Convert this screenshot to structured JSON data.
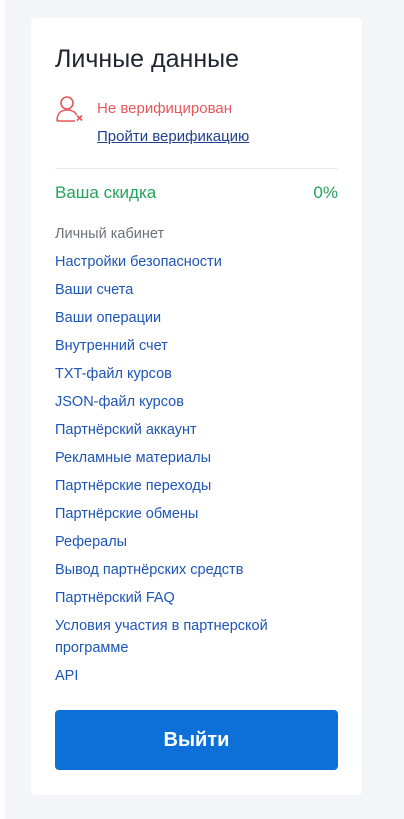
{
  "profile": {
    "title": "Личные данные",
    "verification_status": "Не верифицирован",
    "verification_link": "Пройти верификацию",
    "discount_label": "Ваша скидка",
    "discount_value": "0%"
  },
  "menu": {
    "items": [
      {
        "label": "Личный кабинет"
      },
      {
        "label": "Настройки безопасности"
      },
      {
        "label": "Ваши счета"
      },
      {
        "label": "Ваши операции"
      },
      {
        "label": "Внутренний счет"
      },
      {
        "label": "TXT-файл курсов"
      },
      {
        "label": "JSON-файл курсов"
      },
      {
        "label": "Партнёрский аккаунт"
      },
      {
        "label": "Рекламные материалы"
      },
      {
        "label": "Партнёрские переходы"
      },
      {
        "label": "Партнёрские обмены"
      },
      {
        "label": "Рефералы"
      },
      {
        "label": "Вывод партнёрских средств"
      },
      {
        "label": "Партнёрский FAQ"
      },
      {
        "label": "Условия участия в партнерской программе"
      },
      {
        "label": "API"
      }
    ]
  },
  "logout_label": "Выйти",
  "colors": {
    "danger": "#e8575a",
    "success": "#22a45a",
    "link": "#1d55b8",
    "button": "#0d6fd8"
  },
  "icons": {
    "verification": "user-x-icon"
  }
}
